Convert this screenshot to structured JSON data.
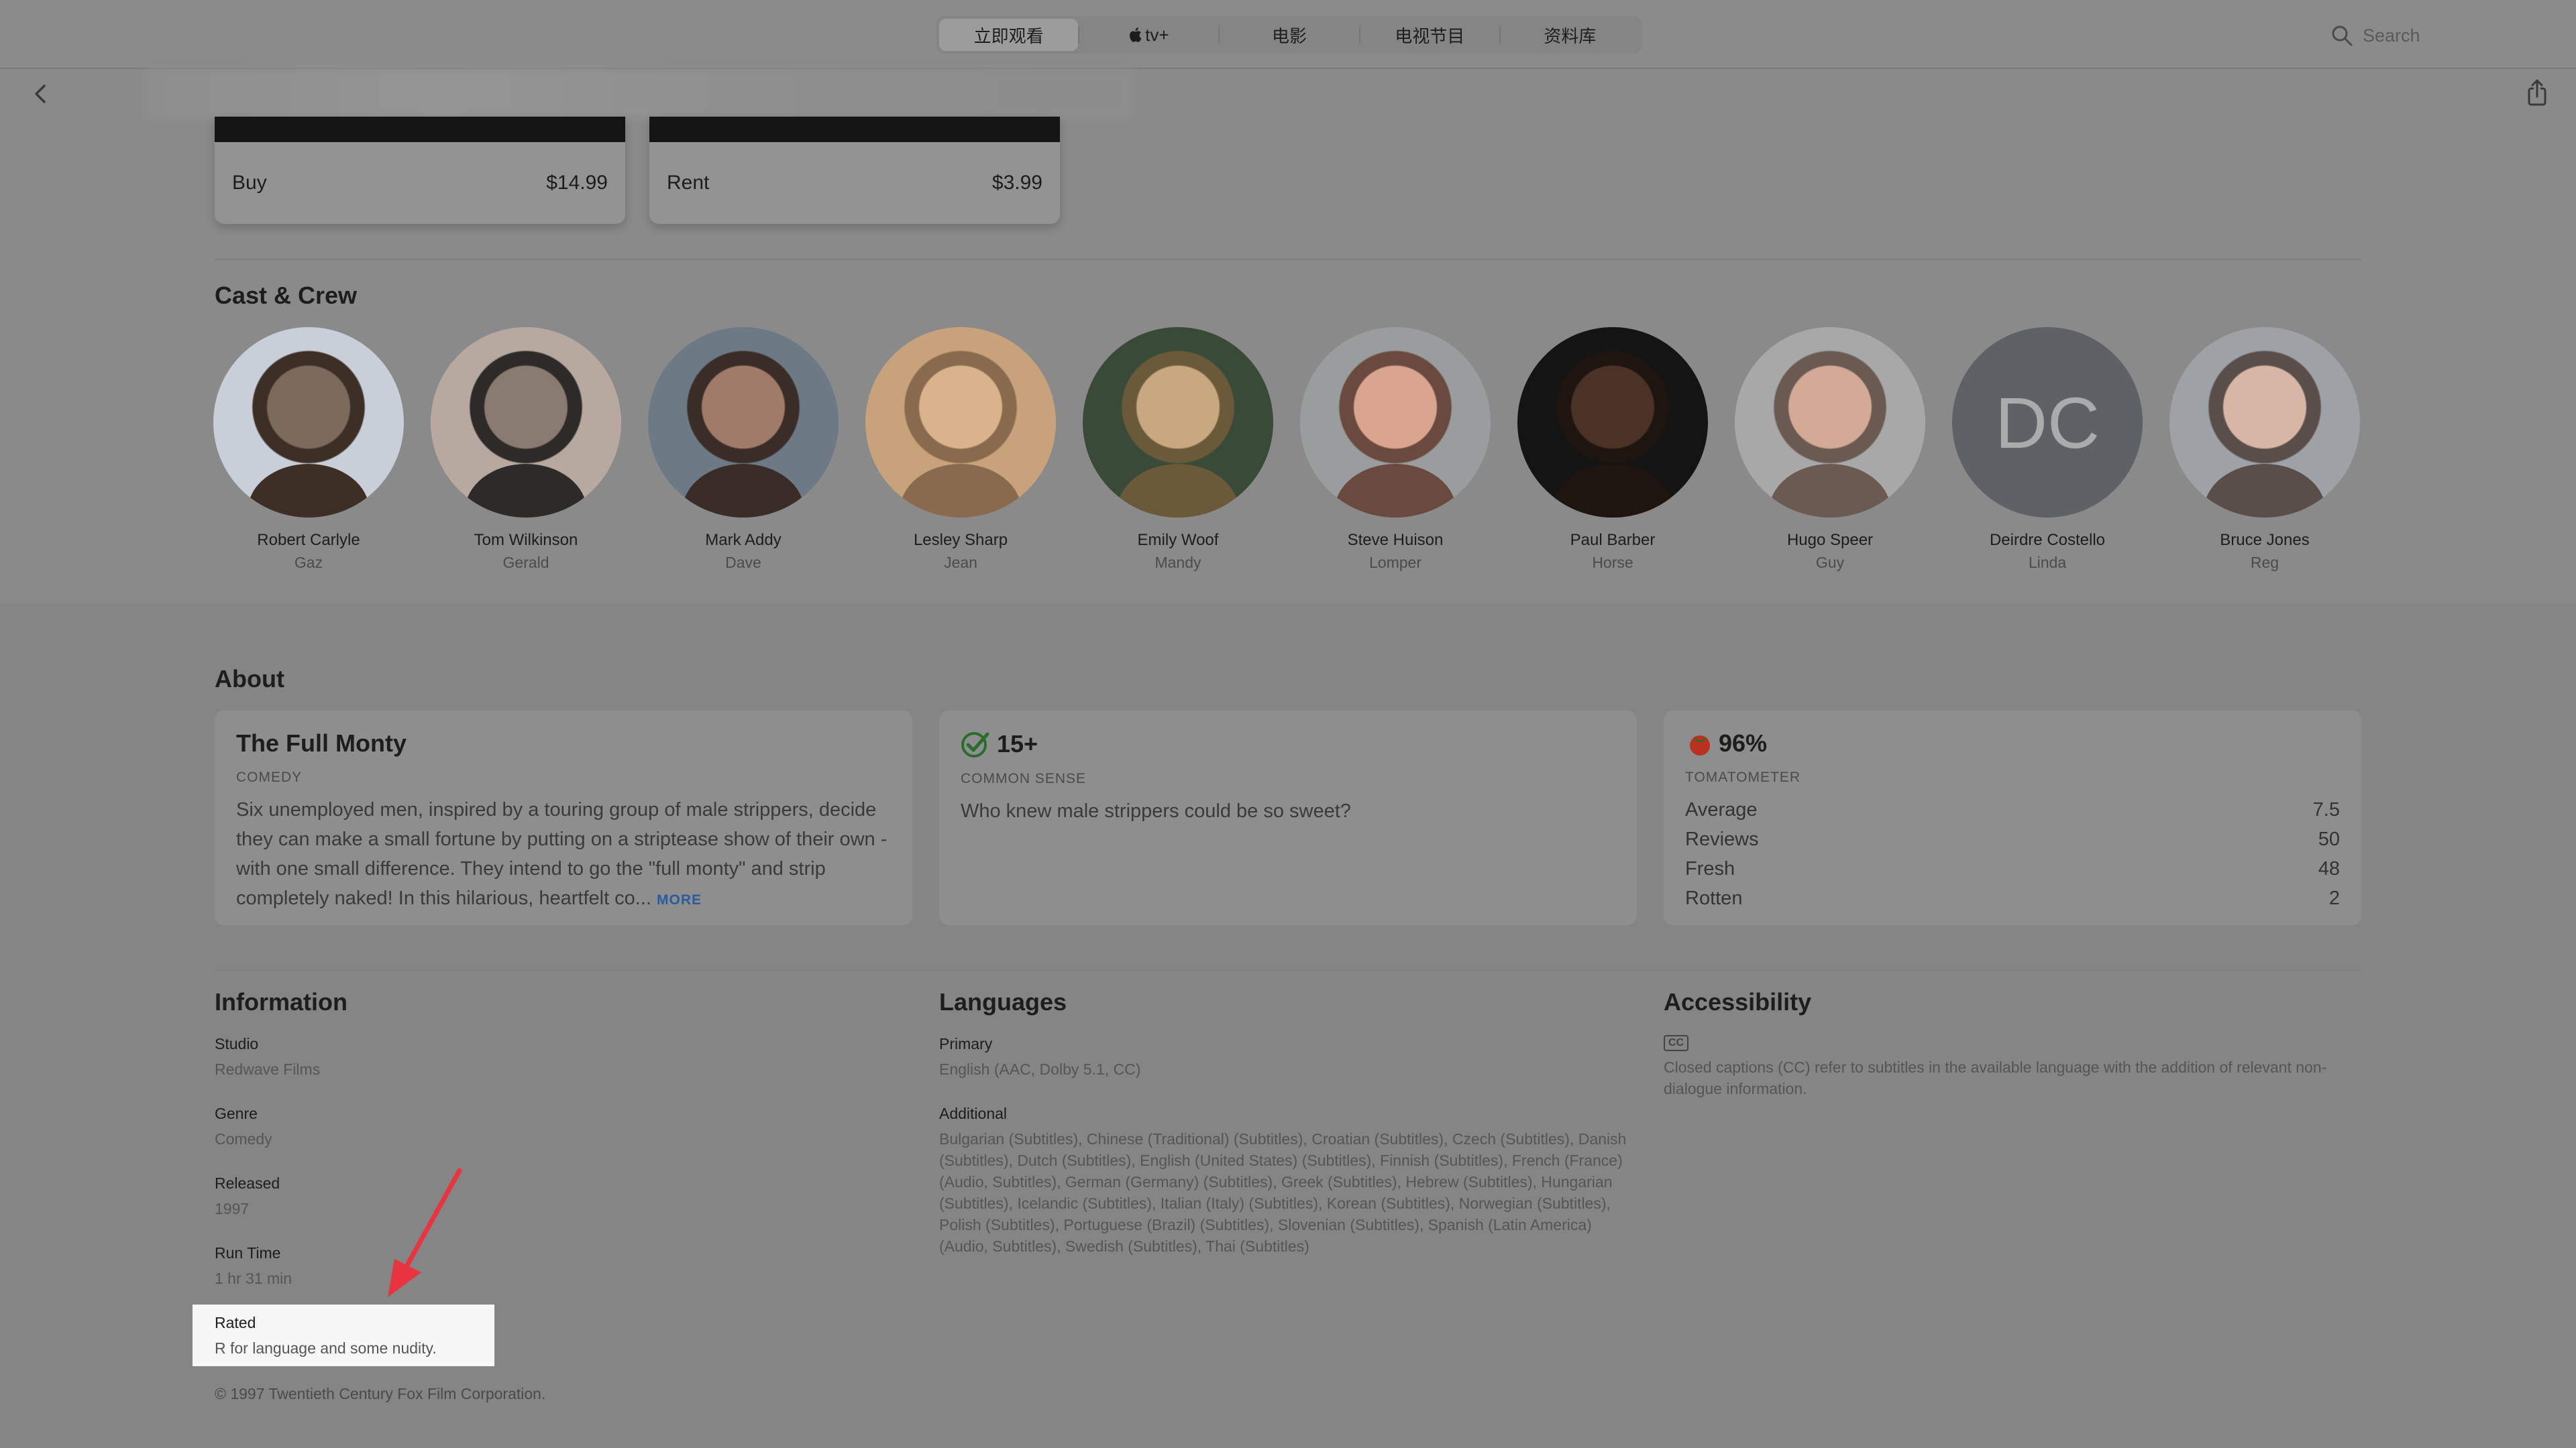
{
  "nav": {
    "tabs": [
      "立即观看",
      "tv+",
      "电影",
      "电视节目",
      "资料库"
    ],
    "search_placeholder": "Search"
  },
  "offers": [
    {
      "label": "Buy",
      "price": "$14.99"
    },
    {
      "label": "Rent",
      "price": "$3.99"
    }
  ],
  "cast_section": {
    "title": "Cast & Crew",
    "members": [
      {
        "name": "Robert Carlyle",
        "role": "Gaz"
      },
      {
        "name": "Tom Wilkinson",
        "role": "Gerald"
      },
      {
        "name": "Mark Addy",
        "role": "Dave"
      },
      {
        "name": "Lesley Sharp",
        "role": "Jean"
      },
      {
        "name": "Emily Woof",
        "role": "Mandy"
      },
      {
        "name": "Steve Huison",
        "role": "Lomper"
      },
      {
        "name": "Paul Barber",
        "role": "Horse"
      },
      {
        "name": "Hugo Speer",
        "role": "Guy"
      },
      {
        "name": "Deirdre Costello",
        "role": "Linda",
        "initials": "DC"
      },
      {
        "name": "Bruce Jones",
        "role": "Reg"
      }
    ]
  },
  "about": {
    "title": "About",
    "movie": {
      "title": "The Full Monty",
      "genre": "COMEDY",
      "summary": "Six unemployed men, inspired by a touring group of male strippers, decide they can make a small fortune by putting on a striptease show of their own - with one small difference. They intend to go the \"full monty\" and strip completely naked! In this hilarious, heartfelt co...",
      "more": "MORE"
    },
    "common_sense": {
      "rating": "15+",
      "label": "COMMON SENSE",
      "text": "Who knew male strippers could be so sweet?"
    },
    "tomatometer": {
      "score": "96%",
      "label": "TOMATOMETER",
      "stats": [
        {
          "label": "Average",
          "value": "7.5"
        },
        {
          "label": "Reviews",
          "value": "50"
        },
        {
          "label": "Fresh",
          "value": "48"
        },
        {
          "label": "Rotten",
          "value": "2"
        }
      ]
    }
  },
  "information": {
    "title": "Information",
    "items": [
      {
        "label": "Studio",
        "value": "Redwave Films"
      },
      {
        "label": "Genre",
        "value": "Comedy"
      },
      {
        "label": "Released",
        "value": "1997"
      },
      {
        "label": "Run Time",
        "value": "1 hr 31 min"
      },
      {
        "label": "Rated",
        "value": "R for language and some nudity."
      }
    ]
  },
  "languages": {
    "title": "Languages",
    "primary_label": "Primary",
    "primary_value": "English (AAC, Dolby 5.1, CC)",
    "additional_label": "Additional",
    "additional_value": "Bulgarian (Subtitles), Chinese (Traditional) (Subtitles), Croatian (Subtitles), Czech (Subtitles), Danish (Subtitles), Dutch (Subtitles), English (United States) (Subtitles), Finnish (Subtitles), French (France) (Audio, Subtitles), German (Germany) (Subtitles), Greek (Subtitles), Hebrew (Subtitles), Hungarian (Subtitles), Icelandic (Subtitles), Italian (Italy) (Subtitles), Korean (Subtitles), Norwegian (Subtitles), Polish (Subtitles), Portuguese (Brazil) (Subtitles), Slovenian (Subtitles), Spanish (Latin America) (Audio, Subtitles), Swedish (Subtitles), Thai (Subtitles)"
  },
  "accessibility": {
    "title": "Accessibility",
    "badge": "CC",
    "text": "Closed captions (CC) refer to subtitles in the available language with the addition of relevant non-dialogue information."
  },
  "copyright": "© 1997 Twentieth Century Fox Film Corporation.",
  "colors": {
    "highlight": "#f7f7f7",
    "arrow": "#e8343f",
    "link": "#2c5b9a"
  }
}
